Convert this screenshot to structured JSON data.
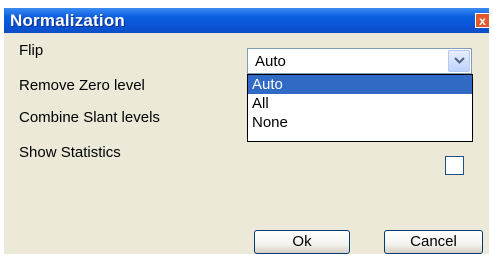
{
  "dialog": {
    "title": "Normalization",
    "close_glyph": "x"
  },
  "fields": {
    "flip_label": "Flip",
    "remove_zero_label": "Remove Zero level",
    "combine_slant_label": "Combine Slant levels",
    "show_statistics_label": "Show Statistics"
  },
  "flip_combo": {
    "selected": "Auto",
    "options": [
      "Auto",
      "All",
      "None"
    ],
    "highlighted_index": 0
  },
  "show_statistics_checked": false,
  "buttons": {
    "ok": "Ok",
    "cancel": "Cancel"
  },
  "colors": {
    "title_bar": "#0a54d8",
    "selection": "#316ac5",
    "dialog_bg": "#ece9d8"
  }
}
